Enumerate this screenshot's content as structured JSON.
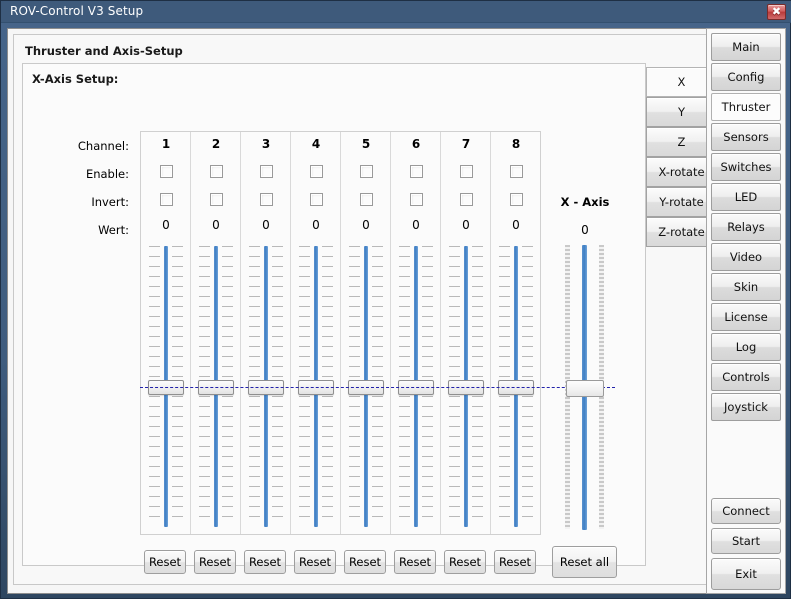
{
  "window": {
    "title": "ROV-Control V3 Setup",
    "close_icon": "close-icon",
    "close_glyph": "✖",
    "titlebar_color": "#3e5a7b",
    "close_color": "#c04a4a"
  },
  "page": {
    "title": "Thruster and Axis-Setup",
    "group_title": "X-Axis Setup:"
  },
  "labels": {
    "channel": "Channel:",
    "enable": "Enable:",
    "invert": "Invert:",
    "wert": "Wert:"
  },
  "channels": [
    {
      "number": "1",
      "enable": false,
      "invert": false,
      "wert": "0",
      "slider_value": 0,
      "reset_label": "Reset"
    },
    {
      "number": "2",
      "enable": false,
      "invert": false,
      "wert": "0",
      "slider_value": 0,
      "reset_label": "Reset"
    },
    {
      "number": "3",
      "enable": false,
      "invert": false,
      "wert": "0",
      "slider_value": 0,
      "reset_label": "Reset"
    },
    {
      "number": "4",
      "enable": false,
      "invert": false,
      "wert": "0",
      "slider_value": 0,
      "reset_label": "Reset"
    },
    {
      "number": "5",
      "enable": false,
      "invert": false,
      "wert": "0",
      "slider_value": 0,
      "reset_label": "Reset"
    },
    {
      "number": "6",
      "enable": false,
      "invert": false,
      "wert": "0",
      "slider_value": 0,
      "reset_label": "Reset"
    },
    {
      "number": "7",
      "enable": false,
      "invert": false,
      "wert": "0",
      "slider_value": 0,
      "reset_label": "Reset"
    },
    {
      "number": "8",
      "enable": false,
      "invert": false,
      "wert": "0",
      "slider_value": 0,
      "reset_label": "Reset"
    }
  ],
  "axis": {
    "title": "X - Axis",
    "value": "0",
    "slider_value": 0,
    "reset_all_label": "Reset all"
  },
  "axis_tabs": [
    {
      "label": "X",
      "active": true
    },
    {
      "label": "Y",
      "active": false
    },
    {
      "label": "Z",
      "active": false
    },
    {
      "label": "X-rotate",
      "active": false
    },
    {
      "label": "Y-rotate",
      "active": false
    },
    {
      "label": "Z-rotate",
      "active": false
    }
  ],
  "nav": {
    "items": [
      {
        "label": "Main",
        "active": false
      },
      {
        "label": "Config",
        "active": false
      },
      {
        "label": "Thruster",
        "active": true
      },
      {
        "label": "Sensors",
        "active": false
      },
      {
        "label": "Switches",
        "active": false
      },
      {
        "label": "LED",
        "active": false
      },
      {
        "label": "Relays",
        "active": false
      },
      {
        "label": "Video",
        "active": false
      },
      {
        "label": "Skin",
        "active": false
      },
      {
        "label": "License",
        "active": false
      },
      {
        "label": "Log",
        "active": false
      },
      {
        "label": "Controls",
        "active": false
      },
      {
        "label": "Joystick",
        "active": false
      }
    ],
    "actions": [
      {
        "label": "Connect"
      },
      {
        "label": "Start"
      },
      {
        "label": "Exit"
      }
    ]
  },
  "theme": {
    "accent_blue": "#3f7fc4",
    "center_line_color": "#2222aa",
    "panel_bg": "#fbfbfb"
  }
}
